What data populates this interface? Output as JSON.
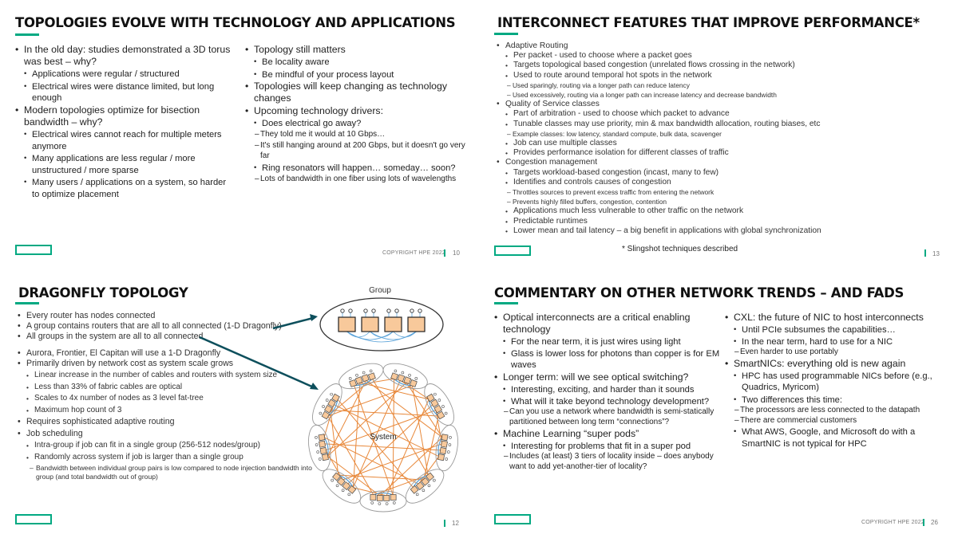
{
  "slides": [
    {
      "title": "TOPOLOGIES EVOLVE WITH TECHNOLOGY AND APPLICATIONS",
      "left": {
        "b1": "In the old day:  studies demonstrated a 3D torus was best – why?",
        "b1_s1": "Applications were regular / structured",
        "b1_s2": "Electrical wires were distance limited, but long enough",
        "b2": "Modern topologies optimize for bisection bandwidth – why?",
        "b2_s1": "Electrical wires cannot reach for multiple meters anymore",
        "b2_s2": "Many applications are less regular / more unstructured / more sparse",
        "b2_s3": "Many users / applications on a system, so harder to optimize placement"
      },
      "right": {
        "b1": "Topology still matters",
        "b1_s1": "Be locality aware",
        "b1_s2": "Be mindful of your process layout",
        "b2": "Topologies will keep changing as technology changes",
        "b3": "Upcoming technology drivers:",
        "b3_s1": "Does electrical go away?",
        "b3_s1_d1": "They told me it would at 10 Gbps…",
        "b3_s1_d2": "It's still hanging around at 200 Gbps, but it doesn't go very far",
        "b3_s2": "Ring resonators will happen… someday… soon?",
        "b3_s2_d1": "Lots of bandwidth in one fiber using lots of wavelengths"
      },
      "copyright": "COPYRIGHT HPE 2022",
      "page": "10"
    },
    {
      "title": "INTERCONNECT FEATURES THAT IMPROVE PERFORMANCE*",
      "items": {
        "b1": "Adaptive Routing",
        "b1_s1": "Per packet - used to choose where a packet goes",
        "b1_s2": "Targets topological based congestion (unrelated flows crossing in the network)",
        "b1_s3": "Used to route around temporal hot spots in the network",
        "b1_s3_d1": "Used sparingly, routing via a longer path can reduce latency",
        "b1_s3_d2": "Used excessively, routing via a longer path can increase latency and decrease bandwidth",
        "b2": "Quality of Service classes",
        "b2_s1": "Part of arbitration - used to choose which packet to advance",
        "b2_s2": "Tunable classes may use priority, min & max bandwidth allocation, routing biases, etc",
        "b2_s2_d1": "Example classes: low latency, standard compute, bulk data, scavenger",
        "b2_s3": "Job can use multiple classes",
        "b2_s4": "Provides performance isolation for different classes of traffic",
        "b3": "Congestion management",
        "b3_s1": "Targets workload-based congestion (incast, many to few)",
        "b3_s2": "Identifies and controls causes of congestion",
        "b3_s2_d1": "Throttles sources to prevent excess traffic from entering the network",
        "b3_s2_d2": "Prevents highly filled buffers, congestion, contention",
        "b3_s3": "Applications much less vulnerable to other traffic on the network",
        "b3_s4": "Predictable runtimes",
        "b3_s5": "Lower mean and tail latency – a big benefit in applications with global synchronization"
      },
      "footnote": "* Slingshot techniques described",
      "page": "13"
    },
    {
      "title": "DRAGONFLY TOPOLOGY",
      "items": {
        "b1": "Every router has nodes connected",
        "b2": "A group contains routers that are all to all connected (1-D Dragonfly)",
        "b3": "All groups in the system are all to all connected",
        "b4": "Aurora, Frontier, El Capitan will use a 1-D Dragonfly",
        "b5": "Primarily driven by network cost as system scale grows",
        "b5_s1": "Linear increase in the number of cables and routers with system size",
        "b5_s2": "Less than 33% of fabric cables are optical",
        "b5_s3": "Scales to 4x number of nodes as 3 level fat-tree",
        "b5_s4": "Maximum hop count of 3",
        "b6": "Requires sophisticated adaptive routing",
        "b7": "Job scheduling",
        "b7_s1": "Intra-group if job can fit in a single group (256-512 nodes/group)",
        "b7_s2": "Randomly across system if job is larger than a single group",
        "b7_s2_d1": "Bandwidth between individual group pairs is low compared to node injection bandwidth into group (and total bandwidth out of group)"
      },
      "diagram": {
        "group_label": "Group",
        "system_label": "System",
        "router_count_per_group": 4,
        "group_count": 9,
        "router_color": "#f8c99b",
        "global_link_color": "#e8883a",
        "local_link_color": "#5ba3d9",
        "arrow_color": "#0d4f5c"
      },
      "page": "12"
    },
    {
      "title": "COMMENTARY ON OTHER NETWORK TRENDS – AND FADS",
      "left": {
        "b1": "Optical interconnects are a critical enabling technology",
        "b1_s1": "For the near term, it is just wires using light",
        "b1_s2": "Glass is lower loss for photons than copper is for EM waves",
        "b2": "Longer term: will we see optical switching?",
        "b2_s1": "Interesting, exciting, and harder than it sounds",
        "b2_s2": "What will it take beyond technology development?",
        "b2_s2_d1": "Can you use a network where bandwidth is semi-statically partitioned between long term “connections”?",
        "b3": "Machine Learning “super pods”",
        "b3_s1": "Interesting for problems that fit in a super pod",
        "b3_s1_d1": "Includes (at least) 3 tiers of locality inside – does anybody want to add yet-another-tier of locality?"
      },
      "right": {
        "b1": "CXL:  the future of NIC to host interconnects",
        "b1_s1": "Until PCIe subsumes the capabilities…",
        "b1_s2": "In the near term, hard to use for a NIC",
        "b1_s2_d1": "Even harder to use portably",
        "b2": "SmartNICs: everything old is new again",
        "b2_s1": "HPC has used programmable NICs before (e.g., Quadrics, Myricom)",
        "b2_s2": "Two differences this time:",
        "b2_s2_d1": "The processors are less connected to the datapath",
        "b2_s2_d2": "There are commercial customers",
        "b2_s3": "What AWS, Google, and Microsoft do with a SmartNIC is not typical for HPC"
      },
      "copyright": "COPYRIGHT HPE 2022",
      "page": "26"
    }
  ],
  "dash": "–",
  "colors": {
    "accent": "#01a982",
    "text": "#222222"
  }
}
